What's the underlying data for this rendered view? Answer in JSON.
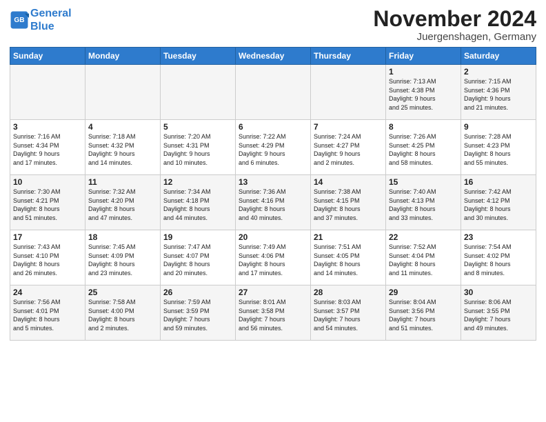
{
  "header": {
    "logo_line1": "General",
    "logo_line2": "Blue",
    "month_title": "November 2024",
    "location": "Juergenshagen, Germany"
  },
  "columns": [
    "Sunday",
    "Monday",
    "Tuesday",
    "Wednesday",
    "Thursday",
    "Friday",
    "Saturday"
  ],
  "weeks": [
    [
      {
        "day": "",
        "info": ""
      },
      {
        "day": "",
        "info": ""
      },
      {
        "day": "",
        "info": ""
      },
      {
        "day": "",
        "info": ""
      },
      {
        "day": "",
        "info": ""
      },
      {
        "day": "1",
        "info": "Sunrise: 7:13 AM\nSunset: 4:38 PM\nDaylight: 9 hours\nand 25 minutes."
      },
      {
        "day": "2",
        "info": "Sunrise: 7:15 AM\nSunset: 4:36 PM\nDaylight: 9 hours\nand 21 minutes."
      }
    ],
    [
      {
        "day": "3",
        "info": "Sunrise: 7:16 AM\nSunset: 4:34 PM\nDaylight: 9 hours\nand 17 minutes."
      },
      {
        "day": "4",
        "info": "Sunrise: 7:18 AM\nSunset: 4:32 PM\nDaylight: 9 hours\nand 14 minutes."
      },
      {
        "day": "5",
        "info": "Sunrise: 7:20 AM\nSunset: 4:31 PM\nDaylight: 9 hours\nand 10 minutes."
      },
      {
        "day": "6",
        "info": "Sunrise: 7:22 AM\nSunset: 4:29 PM\nDaylight: 9 hours\nand 6 minutes."
      },
      {
        "day": "7",
        "info": "Sunrise: 7:24 AM\nSunset: 4:27 PM\nDaylight: 9 hours\nand 2 minutes."
      },
      {
        "day": "8",
        "info": "Sunrise: 7:26 AM\nSunset: 4:25 PM\nDaylight: 8 hours\nand 58 minutes."
      },
      {
        "day": "9",
        "info": "Sunrise: 7:28 AM\nSunset: 4:23 PM\nDaylight: 8 hours\nand 55 minutes."
      }
    ],
    [
      {
        "day": "10",
        "info": "Sunrise: 7:30 AM\nSunset: 4:21 PM\nDaylight: 8 hours\nand 51 minutes."
      },
      {
        "day": "11",
        "info": "Sunrise: 7:32 AM\nSunset: 4:20 PM\nDaylight: 8 hours\nand 47 minutes."
      },
      {
        "day": "12",
        "info": "Sunrise: 7:34 AM\nSunset: 4:18 PM\nDaylight: 8 hours\nand 44 minutes."
      },
      {
        "day": "13",
        "info": "Sunrise: 7:36 AM\nSunset: 4:16 PM\nDaylight: 8 hours\nand 40 minutes."
      },
      {
        "day": "14",
        "info": "Sunrise: 7:38 AM\nSunset: 4:15 PM\nDaylight: 8 hours\nand 37 minutes."
      },
      {
        "day": "15",
        "info": "Sunrise: 7:40 AM\nSunset: 4:13 PM\nDaylight: 8 hours\nand 33 minutes."
      },
      {
        "day": "16",
        "info": "Sunrise: 7:42 AM\nSunset: 4:12 PM\nDaylight: 8 hours\nand 30 minutes."
      }
    ],
    [
      {
        "day": "17",
        "info": "Sunrise: 7:43 AM\nSunset: 4:10 PM\nDaylight: 8 hours\nand 26 minutes."
      },
      {
        "day": "18",
        "info": "Sunrise: 7:45 AM\nSunset: 4:09 PM\nDaylight: 8 hours\nand 23 minutes."
      },
      {
        "day": "19",
        "info": "Sunrise: 7:47 AM\nSunset: 4:07 PM\nDaylight: 8 hours\nand 20 minutes."
      },
      {
        "day": "20",
        "info": "Sunrise: 7:49 AM\nSunset: 4:06 PM\nDaylight: 8 hours\nand 17 minutes."
      },
      {
        "day": "21",
        "info": "Sunrise: 7:51 AM\nSunset: 4:05 PM\nDaylight: 8 hours\nand 14 minutes."
      },
      {
        "day": "22",
        "info": "Sunrise: 7:52 AM\nSunset: 4:04 PM\nDaylight: 8 hours\nand 11 minutes."
      },
      {
        "day": "23",
        "info": "Sunrise: 7:54 AM\nSunset: 4:02 PM\nDaylight: 8 hours\nand 8 minutes."
      }
    ],
    [
      {
        "day": "24",
        "info": "Sunrise: 7:56 AM\nSunset: 4:01 PM\nDaylight: 8 hours\nand 5 minutes."
      },
      {
        "day": "25",
        "info": "Sunrise: 7:58 AM\nSunset: 4:00 PM\nDaylight: 8 hours\nand 2 minutes."
      },
      {
        "day": "26",
        "info": "Sunrise: 7:59 AM\nSunset: 3:59 PM\nDaylight: 7 hours\nand 59 minutes."
      },
      {
        "day": "27",
        "info": "Sunrise: 8:01 AM\nSunset: 3:58 PM\nDaylight: 7 hours\nand 56 minutes."
      },
      {
        "day": "28",
        "info": "Sunrise: 8:03 AM\nSunset: 3:57 PM\nDaylight: 7 hours\nand 54 minutes."
      },
      {
        "day": "29",
        "info": "Sunrise: 8:04 AM\nSunset: 3:56 PM\nDaylight: 7 hours\nand 51 minutes."
      },
      {
        "day": "30",
        "info": "Sunrise: 8:06 AM\nSunset: 3:55 PM\nDaylight: 7 hours\nand 49 minutes."
      }
    ]
  ]
}
